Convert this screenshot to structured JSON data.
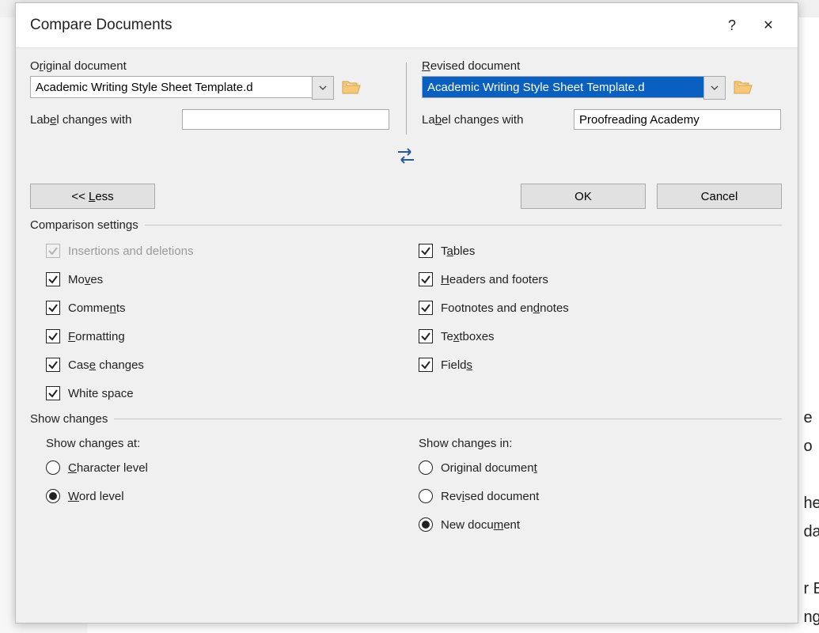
{
  "dialog": {
    "title": "Compare Documents",
    "help_glyph": "?",
    "close_glyph": "✕"
  },
  "original": {
    "section_label_pre": "O",
    "section_label_u": "r",
    "section_label_post": "iginal document",
    "document_value": "Academic Writing Style Sheet Template.d",
    "label_changes_pre": "Lab",
    "label_changes_u": "e",
    "label_changes_post": "l changes with",
    "label_changes_value": ""
  },
  "revised": {
    "section_label_pre": "",
    "section_label_u": "R",
    "section_label_post": "evised document",
    "document_value": "Academic Writing Style Sheet Template.d",
    "label_changes_pre": "La",
    "label_changes_u": "b",
    "label_changes_post": "el changes with",
    "label_changes_value": "Proofreading Academy"
  },
  "buttons": {
    "less_label": "<< Less",
    "less_underline": "L",
    "ok": "OK",
    "cancel": "Cancel"
  },
  "groups": {
    "comparison_settings": "Comparison settings",
    "show_changes": "Show changes",
    "show_changes_at": "Show changes at:",
    "show_changes_in": "Show changes in:"
  },
  "settings_left": [
    {
      "label_pre": "Insertions and deletions",
      "u": "",
      "label_post": "",
      "checked": true,
      "disabled": true,
      "name": "insertions-deletions"
    },
    {
      "label_pre": "Mo",
      "u": "v",
      "label_post": "es",
      "checked": true,
      "disabled": false,
      "name": "moves"
    },
    {
      "label_pre": "Comme",
      "u": "n",
      "label_post": "ts",
      "checked": true,
      "disabled": false,
      "name": "comments"
    },
    {
      "label_pre": "",
      "u": "F",
      "label_post": "ormatting",
      "checked": true,
      "disabled": false,
      "name": "formatting"
    },
    {
      "label_pre": "Cas",
      "u": "e",
      "label_post": " changes",
      "checked": true,
      "disabled": false,
      "name": "case-changes"
    },
    {
      "label_pre": "White space",
      "u": "",
      "label_post": "",
      "checked": true,
      "disabled": false,
      "name": "white-space"
    }
  ],
  "settings_right": [
    {
      "label_pre": "T",
      "u": "a",
      "label_post": "bles",
      "checked": true,
      "disabled": false,
      "name": "tables"
    },
    {
      "label_pre": "",
      "u": "H",
      "label_post": "eaders and footers",
      "checked": true,
      "disabled": false,
      "name": "headers-footers"
    },
    {
      "label_pre": "Footnotes and en",
      "u": "d",
      "label_post": "notes",
      "checked": true,
      "disabled": false,
      "name": "footnotes-endnotes"
    },
    {
      "label_pre": "Te",
      "u": "x",
      "label_post": "tboxes",
      "checked": true,
      "disabled": false,
      "name": "textboxes"
    },
    {
      "label_pre": "Field",
      "u": "s",
      "label_post": "",
      "checked": true,
      "disabled": false,
      "name": "fields"
    }
  ],
  "show_at": [
    {
      "label_pre": "",
      "u": "C",
      "label_post": "haracter level",
      "selected": false,
      "name": "character-level"
    },
    {
      "label_pre": "",
      "u": "W",
      "label_post": "ord level",
      "selected": true,
      "name": "word-level"
    }
  ],
  "show_in": [
    {
      "label_pre": "Original documen",
      "u": "t",
      "label_post": "",
      "selected": false,
      "name": "original-document"
    },
    {
      "label_pre": "Rev",
      "u": "i",
      "label_post": "sed document",
      "selected": false,
      "name": "revised-document"
    },
    {
      "label_pre": "New docu",
      "u": "m",
      "label_post": "ent",
      "selected": true,
      "name": "new-document"
    }
  ],
  "background_lines": "e\no\n\nhe\nda\n\nr E\nng"
}
